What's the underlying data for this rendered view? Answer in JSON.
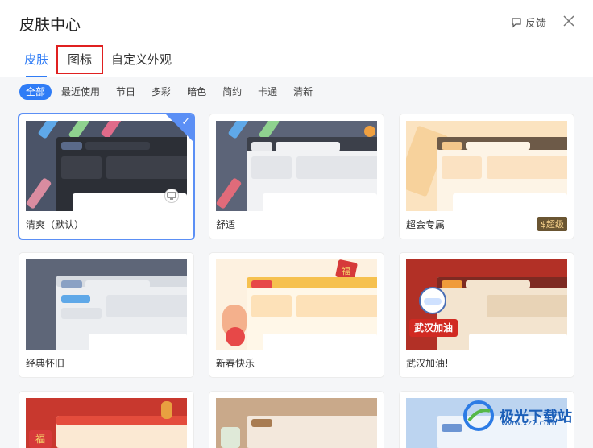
{
  "header": {
    "title": "皮肤中心",
    "feedback_label": "反馈"
  },
  "tabs": [
    {
      "label": "皮肤"
    },
    {
      "label": "图标"
    },
    {
      "label": "自定义外观"
    }
  ],
  "filters": [
    {
      "label": "全部"
    },
    {
      "label": "最近使用"
    },
    {
      "label": "节日"
    },
    {
      "label": "多彩"
    },
    {
      "label": "暗色"
    },
    {
      "label": "简约"
    },
    {
      "label": "卡通"
    },
    {
      "label": "清新"
    }
  ],
  "skins": [
    {
      "label": "清爽（默认）"
    },
    {
      "label": "舒适"
    },
    {
      "label": "超会专属",
      "badge": "$超级"
    },
    {
      "label": "经典怀旧"
    },
    {
      "label": "新春快乐"
    },
    {
      "label": "武汉加油!"
    }
  ],
  "thumb_text": {
    "fu": "福",
    "wuhan": "武汉加油",
    "fu2": "福"
  },
  "watermark": {
    "name": "极光下载站",
    "url": "www.xz7.com"
  },
  "colors": {
    "accent": "#2f7cf6",
    "highlight_box": "#e02020"
  }
}
